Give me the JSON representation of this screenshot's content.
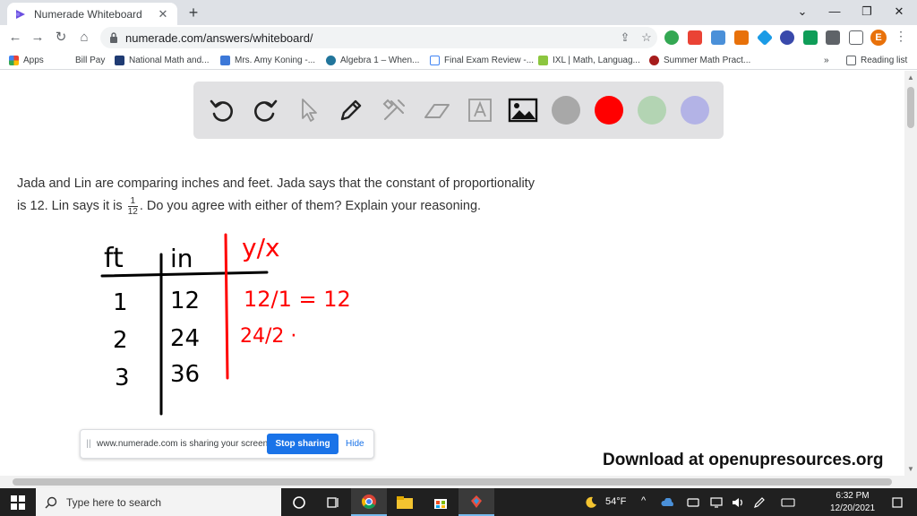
{
  "browser": {
    "tab_title": "Numerade Whiteboard",
    "url": "numerade.com/answers/whiteboard/",
    "avatar_letter": "E",
    "bookmarks": [
      {
        "label": "Apps",
        "color": "#e8453c"
      },
      {
        "label": "Bill Pay",
        "color": "#ffffff"
      },
      {
        "label": "National Math and...",
        "color": "#1f3b73"
      },
      {
        "label": "Mrs. Amy Koning -...",
        "color": "#3c78d8"
      },
      {
        "label": "Algebra 1 – When...",
        "color": "#21759b"
      },
      {
        "label": "Final Exam Review -...",
        "color": "#4285f4"
      },
      {
        "label": "IXL | Math, Languag...",
        "color": "#8cc63f"
      },
      {
        "label": "Summer Math Pract...",
        "color": "#a61c1c"
      }
    ],
    "reading_list": "Reading list"
  },
  "whiteboard": {
    "tools": [
      "undo-icon",
      "redo-icon",
      "pointer-icon",
      "pen-icon",
      "tools-icon",
      "eraser-icon",
      "text-icon",
      "image-icon"
    ],
    "colors": [
      "#a8a8a8",
      "#ff0000",
      "#b3d4b3",
      "#b3b3e6"
    ]
  },
  "question": {
    "part1": "Jada and Lin are comparing inches and feet. Jada says that the constant of proportionality is 12. Lin says it is ",
    "frac_num": "1",
    "frac_den": "12",
    "part2": ". Do you agree with either of them? Explain your reasoning."
  },
  "handwriting": {
    "col_ft": "ft",
    "col_in": "in",
    "col_yx": "y/x",
    "rows": [
      {
        "ft": "1",
        "in": "12",
        "ratio": "12/1 = 12"
      },
      {
        "ft": "2",
        "in": "24",
        "ratio": "24/2 ·"
      },
      {
        "ft": "3",
        "in": "36",
        "ratio": ""
      }
    ]
  },
  "share_bar": {
    "message": "www.numerade.com is sharing your screen.",
    "stop_label": "Stop sharing",
    "hide_label": "Hide"
  },
  "download_text": "Download at openupresources.org",
  "taskbar": {
    "search_placeholder": "Type here to search",
    "weather": "54°F",
    "time": "6:32 PM",
    "date": "12/20/2021"
  }
}
